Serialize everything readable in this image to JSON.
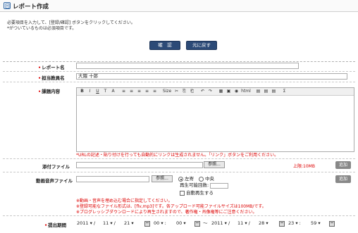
{
  "header": {
    "title": "レポート作成"
  },
  "instructions": {
    "line1": "必要項目を入力して、[登録/確認] ボタンをクリックしてください。",
    "line2": "*がついているものは必須項目です。"
  },
  "buttons": {
    "confirm": "確　認",
    "back": "元に戻す"
  },
  "form": {
    "report_name": {
      "label": "レポート名",
      "value": ""
    },
    "teacher": {
      "label": "担当教員名",
      "value": "大隈 十郎"
    },
    "content": {
      "label": "課題内容"
    },
    "url_note": "*URLの記述・貼り付けを行っても自動的にリンクは生成されません。「リンク」ボタンをご利用ください。",
    "attachment": {
      "label": "添付ファイル",
      "browse": "参照...",
      "limit": "上限:10MB",
      "add": "追加"
    },
    "media": {
      "label": "動画音声ファイル",
      "browse": "参照...",
      "align_left": "左寄",
      "align_center": "中央",
      "repeat_label": "再生可能回数:",
      "autoplay": "自動再生する",
      "add": "追加",
      "note1": "※動画・音声を埋め込む場合に指定してください。",
      "note2": "※登録可能なファイル形式は、[flv,mp3]です。各アップロード可能ファイルサイズは100MB/です。",
      "note3": "※プログレッシブダウンロードにより再生されますので、著作権・肖像権等にご注意ください。"
    },
    "period": {
      "label": "提出期間",
      "start": {
        "year": "2011",
        "month": "11",
        "day": "21",
        "hour": "00",
        "minute": "00"
      },
      "end": {
        "year": "2011",
        "month": "11",
        "day": "28",
        "hour": "23",
        "minute": "59"
      },
      "tilde": "〜"
    }
  },
  "toolbar_items": [
    "B",
    "I",
    "U",
    "T",
    "A",
    "≡",
    "≡",
    "≡",
    "≡",
    "≡",
    "Size",
    "✂",
    "⎘",
    "⎗",
    "↶",
    "↷",
    "▦",
    "▣",
    "◉",
    "html",
    "▤",
    "▤",
    "▤",
    "Σ"
  ]
}
